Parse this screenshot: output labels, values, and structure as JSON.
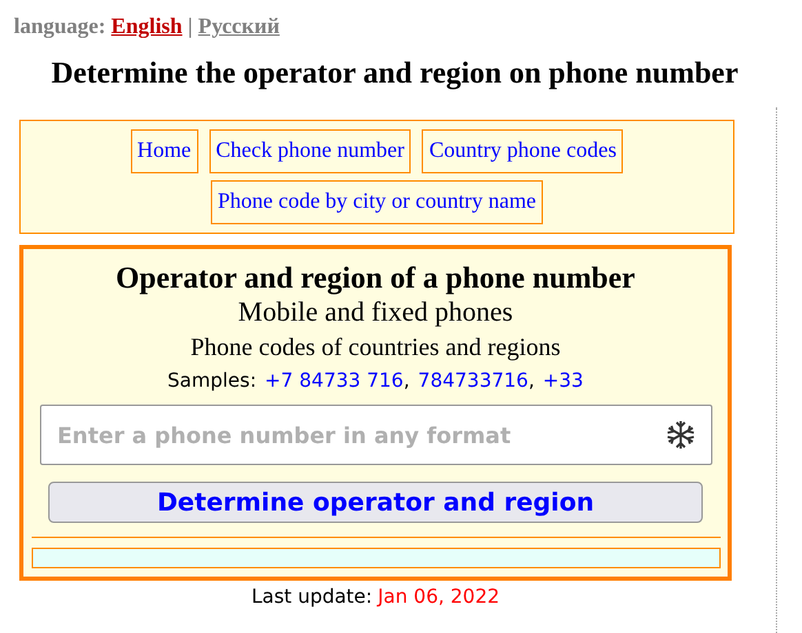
{
  "language": {
    "label": "language:",
    "separator": "|",
    "options": [
      {
        "label": "English",
        "selected": true
      },
      {
        "label": "Русский",
        "selected": false
      }
    ]
  },
  "title": "Determine the operator and region on phone number",
  "nav": [
    "Home",
    "Check phone number",
    "Country phone codes",
    "Phone code by city or country name"
  ],
  "card": {
    "title": "Operator and region of a phone number",
    "subtitle": "Mobile and fixed phones",
    "tagline": "Phone codes of countries and regions",
    "samples_label": "Samples:",
    "samples_separator": ",",
    "samples": [
      "+7 84733 716",
      "784733716",
      "+33"
    ],
    "input": {
      "placeholder": "Enter a phone number in any format"
    },
    "button": "Determine operator and region"
  },
  "footer": {
    "label": "Last update:",
    "date": "Jan 06, 2022"
  }
}
